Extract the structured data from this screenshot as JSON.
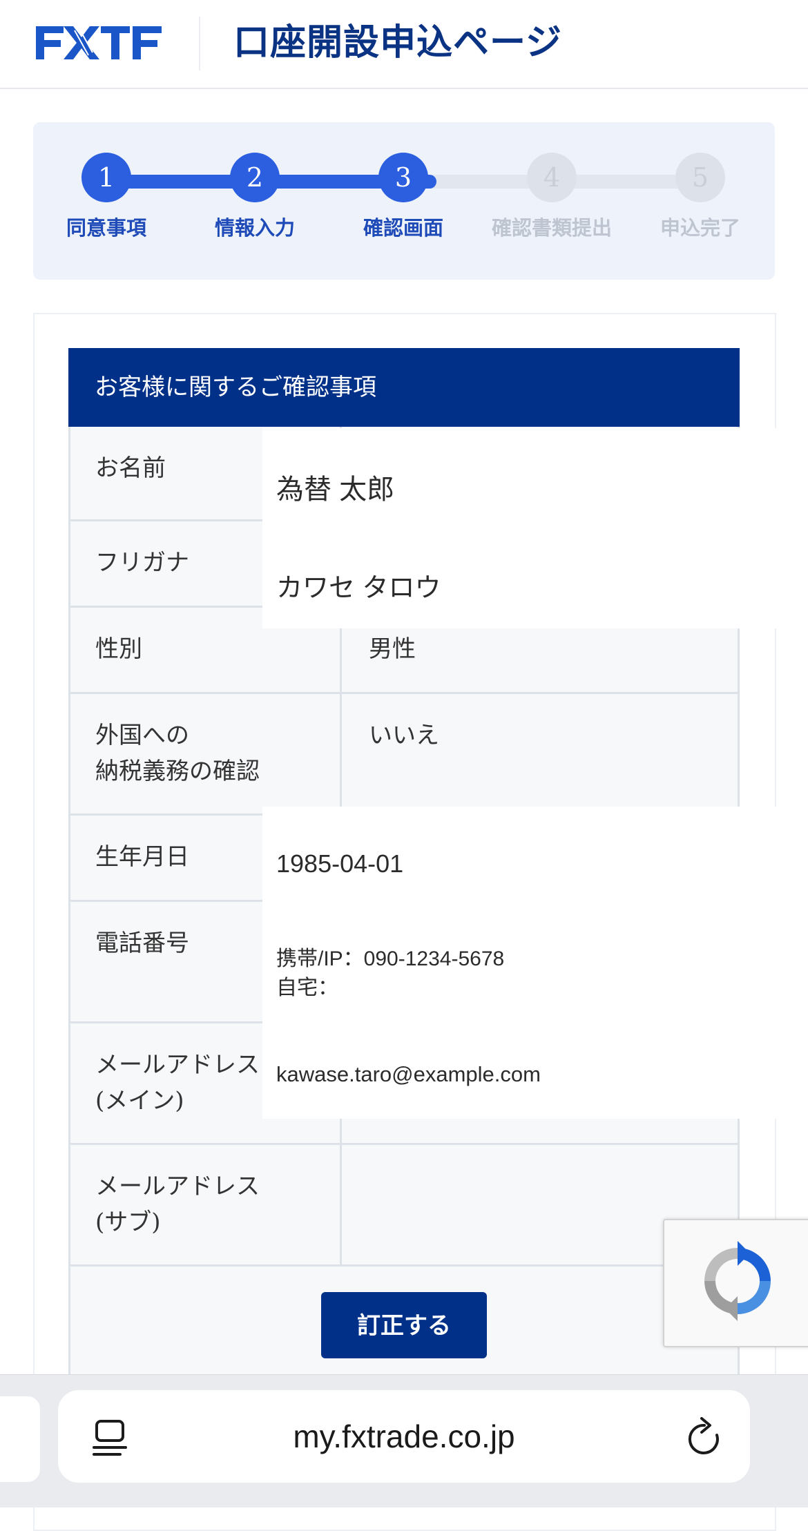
{
  "header": {
    "logo_text": "FXTF",
    "title": "口座開設申込ページ",
    "brand_color": "#003087"
  },
  "steps": [
    {
      "number": "1",
      "label": "同意事項",
      "state": "done"
    },
    {
      "number": "2",
      "label": "情報入力",
      "state": "done"
    },
    {
      "number": "3",
      "label": "確認画面",
      "state": "current"
    },
    {
      "number": "4",
      "label": "確認書類提出",
      "state": "pending"
    },
    {
      "number": "5",
      "label": "申込完了",
      "state": "pending"
    }
  ],
  "section": {
    "title": "お客様に関するご確認事項"
  },
  "fields": {
    "name": {
      "label": "お名前",
      "value": "為替 太郎"
    },
    "furigana": {
      "label": "フリガナ",
      "value": "カワセ タロウ"
    },
    "gender": {
      "label": "性別",
      "value": "男性"
    },
    "tax": {
      "label_line1": "外国への",
      "label_line2": "納税義務の確認",
      "value": "いいえ"
    },
    "birthdate": {
      "label": "生年月日",
      "value": "1985-04-01"
    },
    "phone": {
      "label": "電話番号",
      "mobile": "携帯/IP：090-1234-5678",
      "home": "自宅："
    },
    "email_main": {
      "label_line1": "メールアドレス",
      "label_line2": "(メイン)",
      "value": "kawase.taro@example.com"
    },
    "email_sub": {
      "label_line1": "メールアドレス",
      "label_line2": "(サブ)",
      "value": ""
    }
  },
  "actions": {
    "correct_label": "訂正する"
  },
  "browser": {
    "url": "my.fxtrade.co.jp"
  }
}
